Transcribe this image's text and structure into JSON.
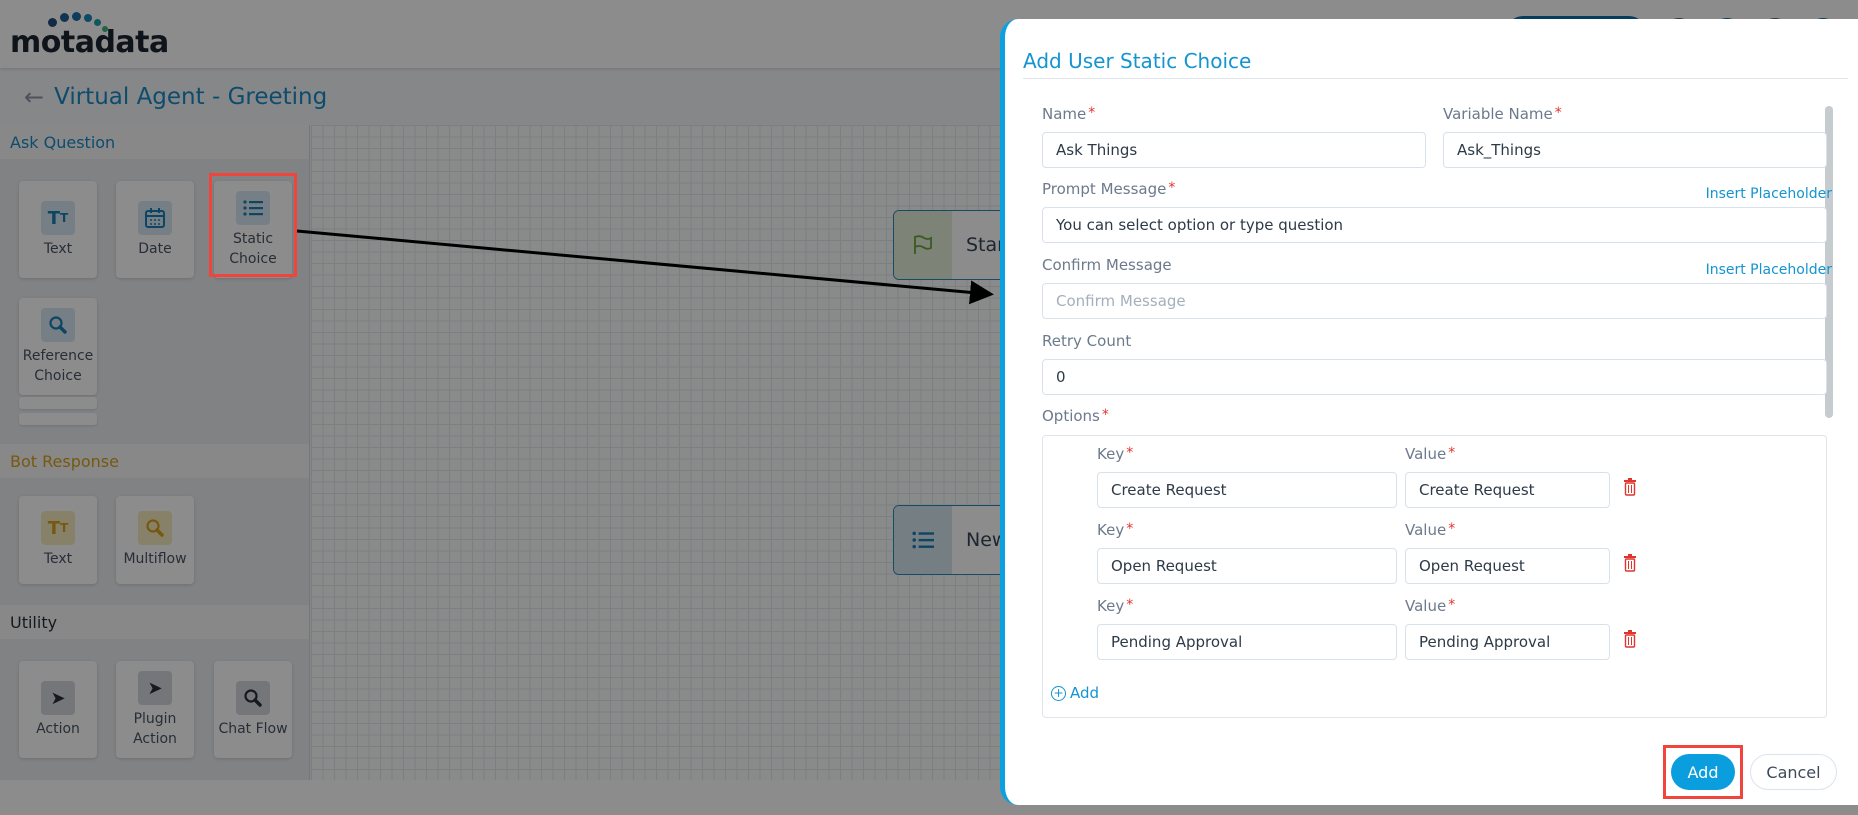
{
  "app": {
    "logo_text": "motadata",
    "page_title": "Virtual Agent - Greeting",
    "back_icon": "arrow-left-icon"
  },
  "left_panel": {
    "sections": [
      {
        "title": "Ask Question",
        "color": "#1a8ac6",
        "tiles": [
          {
            "label": "Text",
            "icon": "text-format-icon"
          },
          {
            "label": "Date",
            "icon": "calendar-icon"
          },
          {
            "label": "Static Choice",
            "icon": "list-icon"
          },
          {
            "label": "Reference Choice",
            "icon": "search-icon"
          }
        ]
      },
      {
        "title": "Bot Response",
        "color": "#d6a31a",
        "tiles": [
          {
            "label": "Text",
            "icon": "text-format-icon"
          },
          {
            "label": "Multiflow",
            "icon": "search-icon"
          }
        ]
      },
      {
        "title": "Utility",
        "color": "#27303b",
        "tiles": [
          {
            "label": "Action",
            "icon": "rocket-icon"
          },
          {
            "label": "Plugin Action",
            "icon": "rocket-icon"
          },
          {
            "label": "Chat Flow",
            "icon": "search-icon"
          }
        ]
      }
    ]
  },
  "canvas": {
    "nodes": [
      {
        "label": "Start",
        "icon": "flag-icon"
      },
      {
        "label": "New",
        "icon": "list-icon"
      }
    ]
  },
  "modal": {
    "title": "Add User Static Choice",
    "fields": {
      "name": {
        "label": "Name",
        "required": "*",
        "value": "Ask Things"
      },
      "variable_name": {
        "label": "Variable Name",
        "required": "*",
        "value": "Ask_Things"
      },
      "prompt_message": {
        "label": "Prompt Message",
        "required": "*",
        "value": "You can select option or type question",
        "link": "Insert Placeholder"
      },
      "confirm_message": {
        "label": "Confirm Message",
        "placeholder": "Confirm Message",
        "value": "",
        "link": "Insert Placeholder"
      },
      "retry_count": {
        "label": "Retry Count",
        "value": "0"
      }
    },
    "options": {
      "label": "Options",
      "required": "*",
      "key_label": "Key",
      "value_label": "Value",
      "rows": [
        {
          "key": "Create Request",
          "value": "Create Request"
        },
        {
          "key": "Open Request",
          "value": "Open Request"
        },
        {
          "key": "Pending Approval",
          "value": "Pending Approval"
        }
      ],
      "add_label": "Add"
    },
    "buttons": {
      "add": "Add",
      "cancel": "Cancel"
    }
  },
  "colors": {
    "accent": "#0b9ede",
    "title_blue": "#1494d0",
    "required_red": "#e0342e",
    "annotation_red": "#f0443d"
  }
}
